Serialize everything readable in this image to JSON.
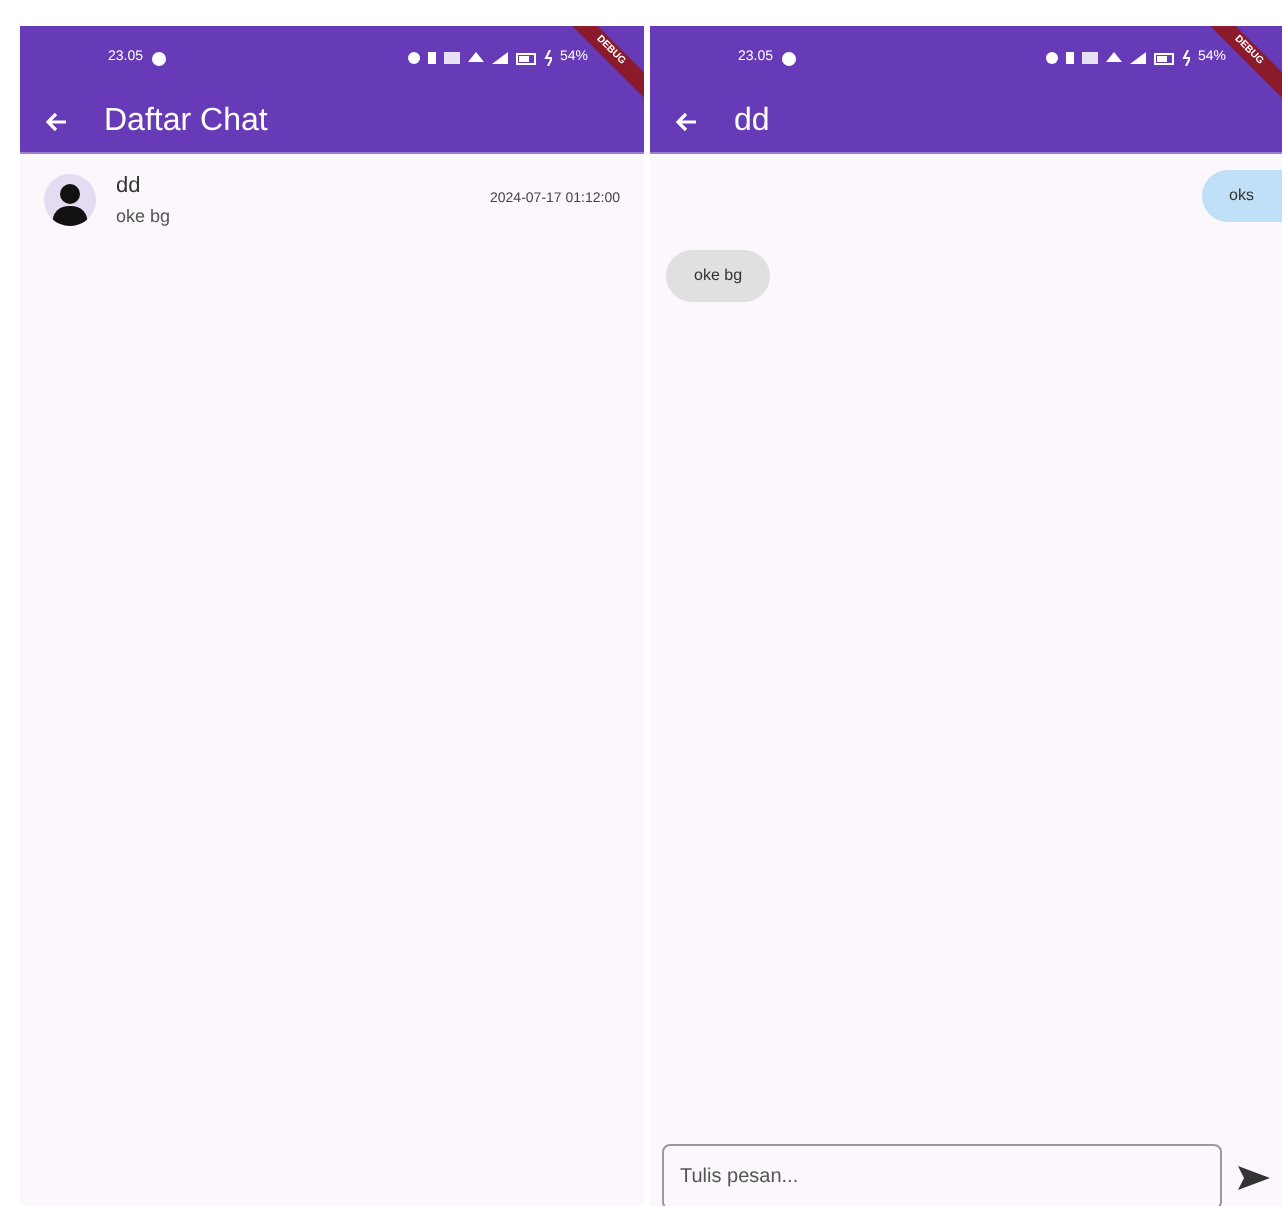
{
  "screens": [
    {
      "kind": "list",
      "status_bar": {
        "time": "23.05",
        "battery": "54%"
      },
      "debug_banner": "DEBUG",
      "title": "Daftar Chat",
      "chats": [
        {
          "name": "dd",
          "last_message": "oke bg",
          "time": "2024-07-17 01:12:00"
        }
      ]
    },
    {
      "kind": "chat",
      "status_bar": {
        "time": "23.05",
        "battery": "54%"
      },
      "debug_banner": "DEBUG",
      "title": "dd",
      "messages": [
        {
          "kind": "sent",
          "text": "oks"
        },
        {
          "kind": "received",
          "text": "oke bg"
        }
      ],
      "composer": {
        "placeholder": "Tulis pesan..."
      }
    }
  ]
}
